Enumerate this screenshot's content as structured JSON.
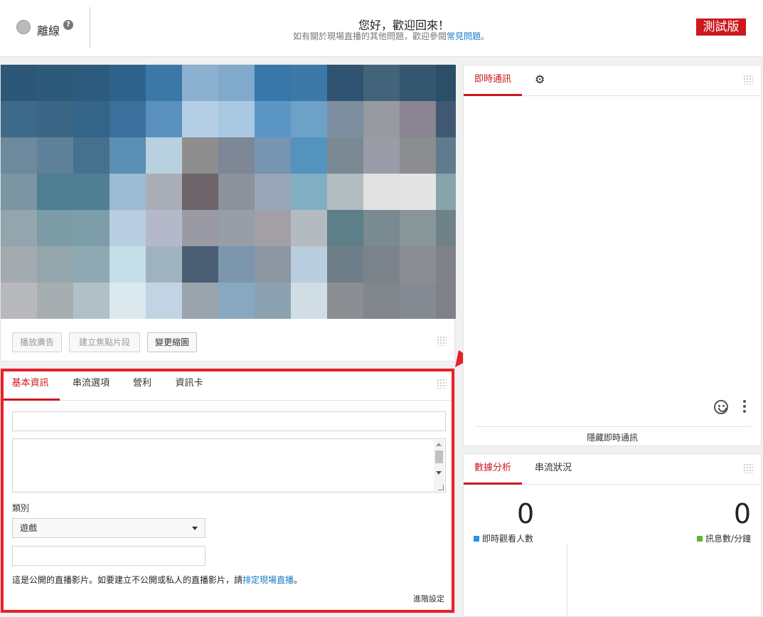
{
  "header": {
    "status": "離線",
    "welcome": "您好，歡迎回來！",
    "subline_prefix": "如有關於現場直播的其他問題，歡迎參閱",
    "subline_link": "常見問題",
    "subline_suffix": "。",
    "beta_badge": "測試版"
  },
  "video": {
    "buttons": {
      "play_ad": "播放廣告",
      "create_highlight": "建立焦點片段",
      "change_thumbnail": "變更縮圖"
    },
    "thumbnail_palette": [
      "#2c5776",
      "#2e5a7a",
      "#2d5b7e",
      "#2e628c",
      "#3b78a8",
      "#8cb1d0",
      "#80a9cc",
      "#3777aa",
      "#3c78a8",
      "#2f5370",
      "#43637a",
      "#35566f",
      "#2c4f68",
      "#3c6a88",
      "#3c6686",
      "#346487",
      "#3c6f9b",
      "#5a90bd",
      "#b4cfe6",
      "#a9c8e2",
      "#5c96c4",
      "#6ea1c7",
      "#7c8ea0",
      "#979aa0",
      "#8b8591",
      "#415873",
      "#6c899e",
      "#5e8199",
      "#45708e",
      "#5b8fb3",
      "#b9d0e0",
      "#8e8e8e",
      "#7d8796",
      "#7695b1",
      "#5393be",
      "#7a8994",
      "#9a9ca8",
      "#8b8d91",
      "#5e7c8e",
      "#7b95a3",
      "#4d7e92",
      "#507f93",
      "#9bbbd3",
      "#a9aeb6",
      "#6c6469",
      "#8b929a",
      "#98a6b8",
      "#82aec3",
      "#b2bcc1",
      "#e1e1e1",
      "#e4e4e4",
      "#88a4ad",
      "#93a5ad",
      "#7b9ca5",
      "#7d9da9",
      "#b9cde2",
      "#b4b9c9",
      "#9a9aa4",
      "#979ea8",
      "#a2a0a5",
      "#b3bbc0",
      "#5d7f88",
      "#7a8a91",
      "#88969a",
      "#6f8288",
      "#a3abb0",
      "#95a5ac",
      "#8ea9b2",
      "#c5dfe9",
      "#9fb2c0",
      "#4a5e74",
      "#7c96ae",
      "#8c97a2",
      "#b9cede",
      "#6d7e88",
      "#7a8389",
      "#8a8d92",
      "#7f8289",
      "#b7b9bc",
      "#a7aeb2",
      "#b1c0c6",
      "#dbe8ee",
      "#c2d3e3",
      "#9aa4ad",
      "#87a8c0",
      "#8da2b0",
      "#d1dde5",
      "#8b8e92",
      "#81858c",
      "#858b92",
      "#7f8189"
    ]
  },
  "info": {
    "tabs": [
      "基本資訊",
      "串流選項",
      "營利",
      "資訊卡"
    ],
    "title_value": "",
    "description_value": "",
    "category_label": "類別",
    "category_value": "遊戲",
    "game_value": "",
    "privacy_prefix": "這是公開的直播影片。如要建立不公開或私人的直播影片，請",
    "privacy_link": "排定現場直播",
    "privacy_suffix": "。",
    "advanced": "進階設定"
  },
  "chat": {
    "tab": "即時通訊",
    "hide": "隱藏即時通訊"
  },
  "analytics": {
    "tabs": [
      "數據分析",
      "串流狀況"
    ],
    "viewers": "0",
    "viewers_label": "即時觀看人數",
    "messages": "0",
    "messages_label": "訊息數/分鐘",
    "viewers_color": "#2793e6",
    "messages_color": "#5fb336"
  },
  "colors": {
    "accent": "#cc181e",
    "link": "#167ac6",
    "annotation": "#e8202a"
  }
}
